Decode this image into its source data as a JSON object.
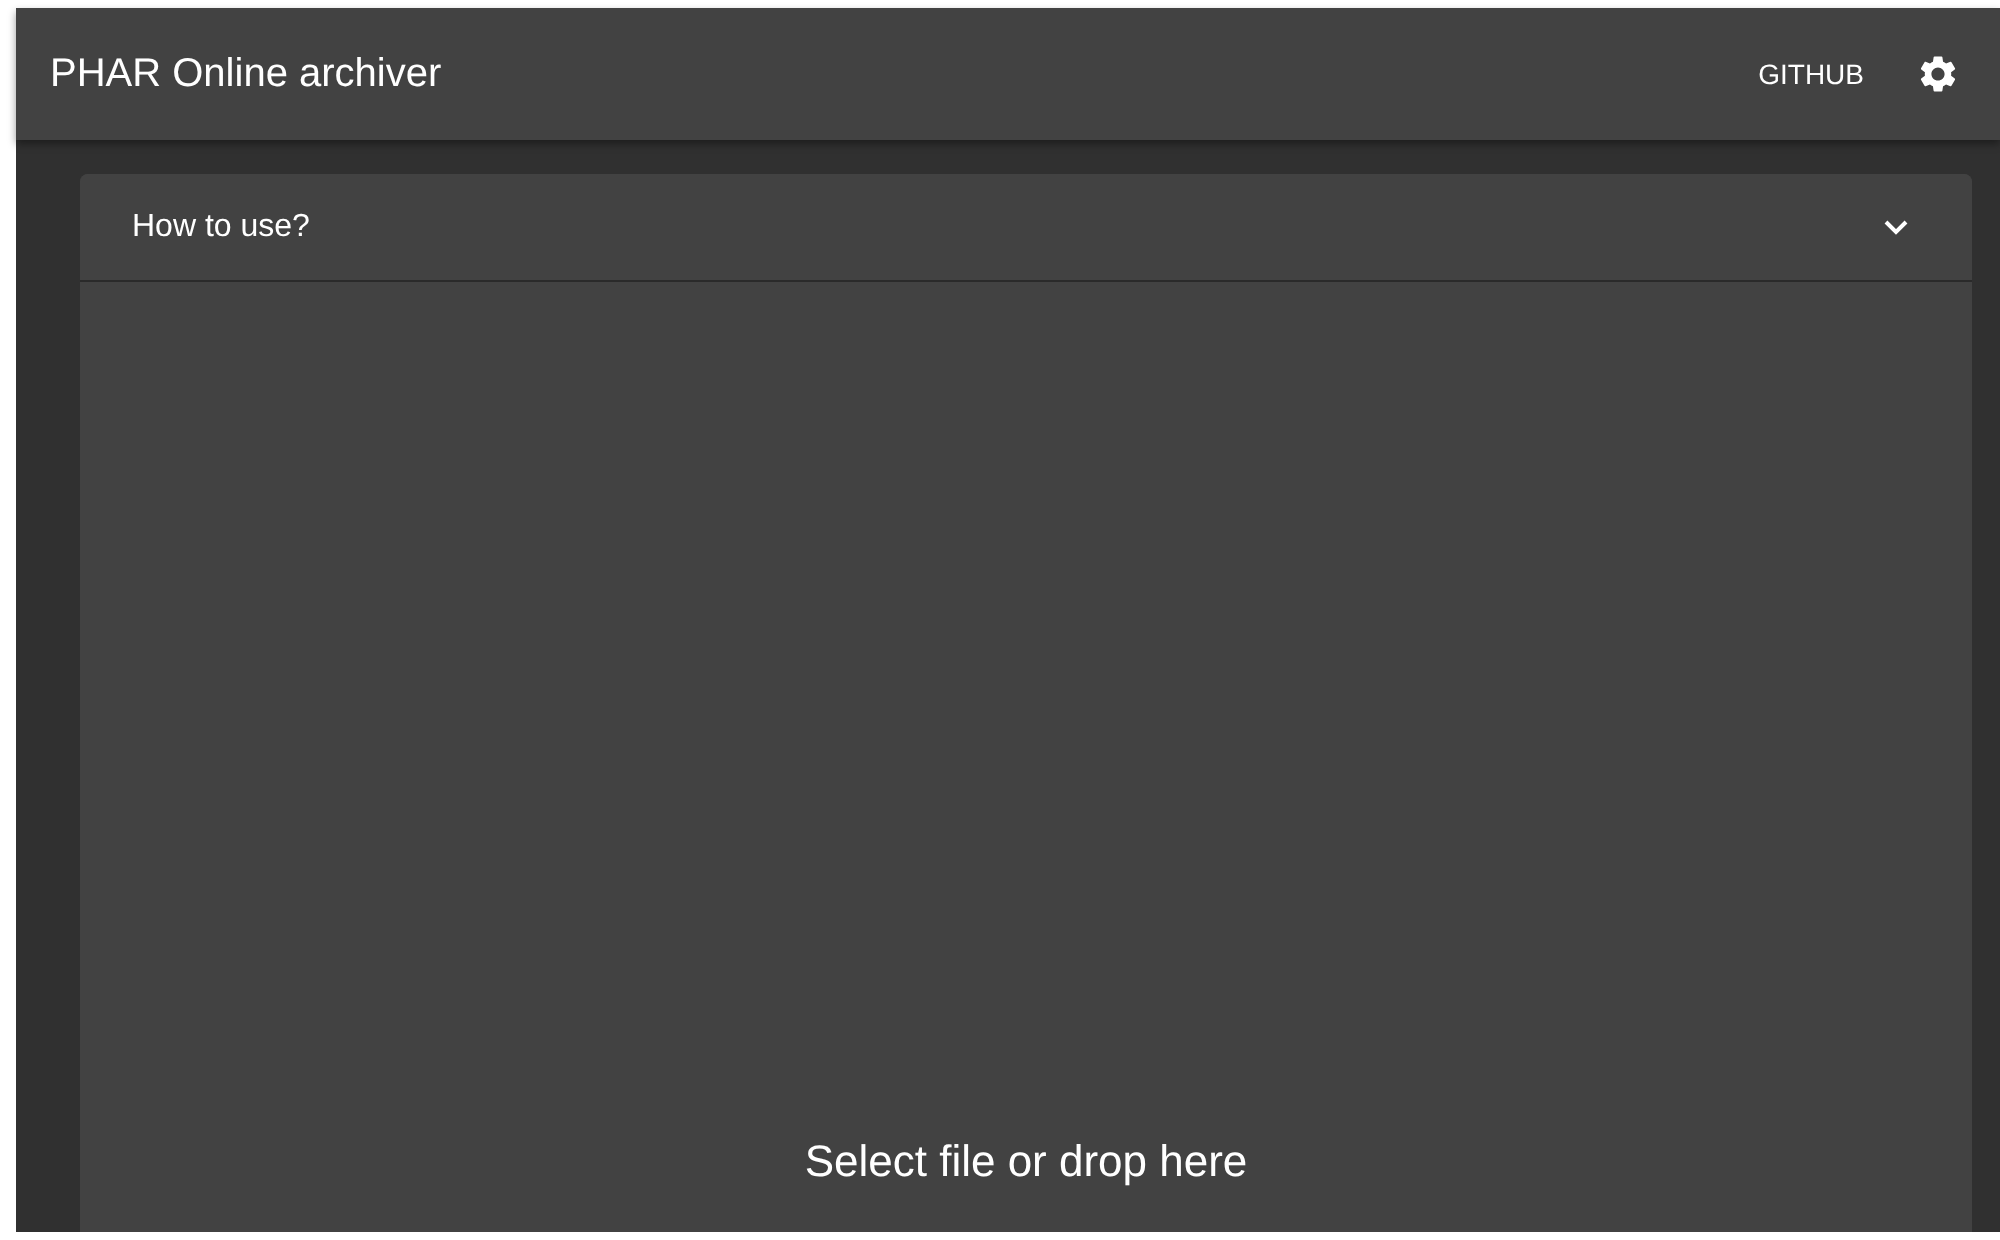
{
  "app_bar": {
    "title": "PHAR Online archiver",
    "link": "GITHUB"
  },
  "help_panel": {
    "title": "How to use?",
    "expanded": false
  },
  "drop_zone": {
    "prompt": "Select file or drop here"
  }
}
